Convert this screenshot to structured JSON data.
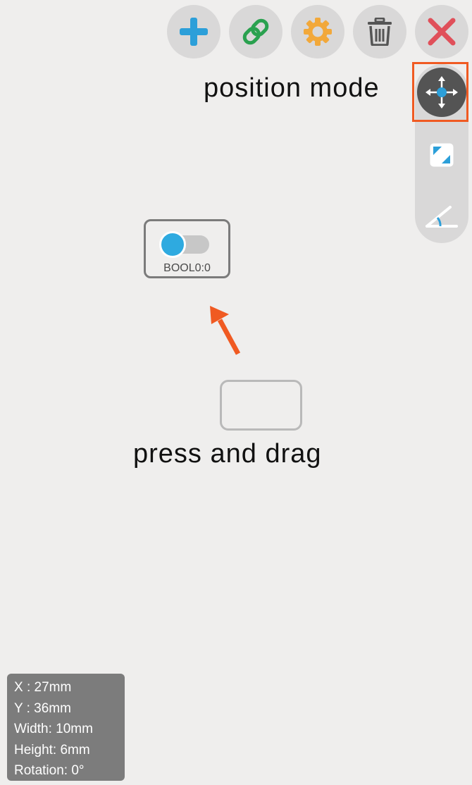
{
  "toolbar": {
    "buttons": [
      {
        "id": "add",
        "icon": "plus-icon",
        "color": "#2c9fd9"
      },
      {
        "id": "link",
        "icon": "link-icon",
        "color": "#2aa14f"
      },
      {
        "id": "settings",
        "icon": "gear-icon",
        "color": "#f2a83a"
      },
      {
        "id": "delete",
        "icon": "trash-icon",
        "color": "#555555"
      },
      {
        "id": "close",
        "icon": "close-icon",
        "color": "#e0505a"
      }
    ]
  },
  "mode_panel": {
    "modes": [
      {
        "id": "position",
        "icon": "move-arrows-icon",
        "active": true
      },
      {
        "id": "size",
        "icon": "resize-icon",
        "active": false
      },
      {
        "id": "rotation",
        "icon": "angle-icon",
        "active": false
      }
    ],
    "highlight_color": "#f05a22"
  },
  "callouts": {
    "position_mode": "position mode",
    "press_and_drag": "press and drag"
  },
  "widget": {
    "type": "toggle-switch",
    "label": "BOOL0:0",
    "knob_color": "#2eaae0"
  },
  "info": {
    "x": "X  : 27mm",
    "y": "Y  : 36mm",
    "width": "Width: 10mm",
    "height": "Height: 6mm",
    "rotation": "Rotation: 0°"
  },
  "colors": {
    "background": "#efeeed",
    "accent": "#2c9fd9",
    "arrow": "#f05a22"
  }
}
